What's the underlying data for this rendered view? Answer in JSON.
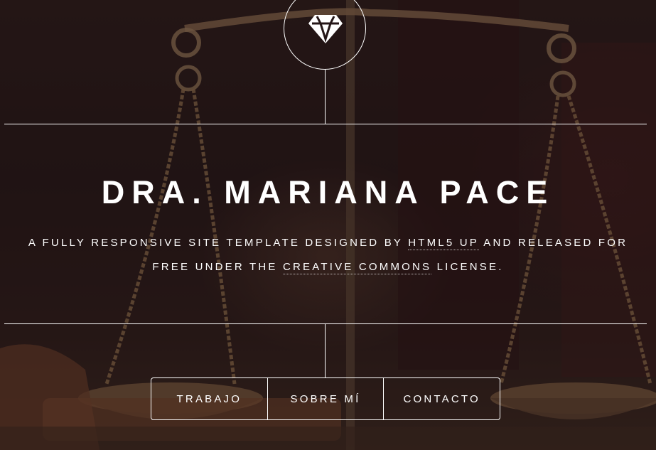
{
  "header": {
    "logo_icon": "diamond-icon",
    "title": "DRA. MARIANA PACE",
    "subtitle": {
      "part1": "A FULLY RESPONSIVE SITE TEMPLATE DESIGNED BY ",
      "link1": "HTML5 UP",
      "part2": " AND RELEASED FOR FREE UNDER THE ",
      "link2": "CREATIVE COMMONS",
      "part3": " LICENSE."
    }
  },
  "nav": {
    "items": [
      {
        "label": "TRABAJO"
      },
      {
        "label": "SOBRE MÍ"
      },
      {
        "label": "CONTACTO"
      }
    ]
  },
  "colors": {
    "text": "#ffffff",
    "background": "#241617",
    "lines": "#ffffff"
  }
}
